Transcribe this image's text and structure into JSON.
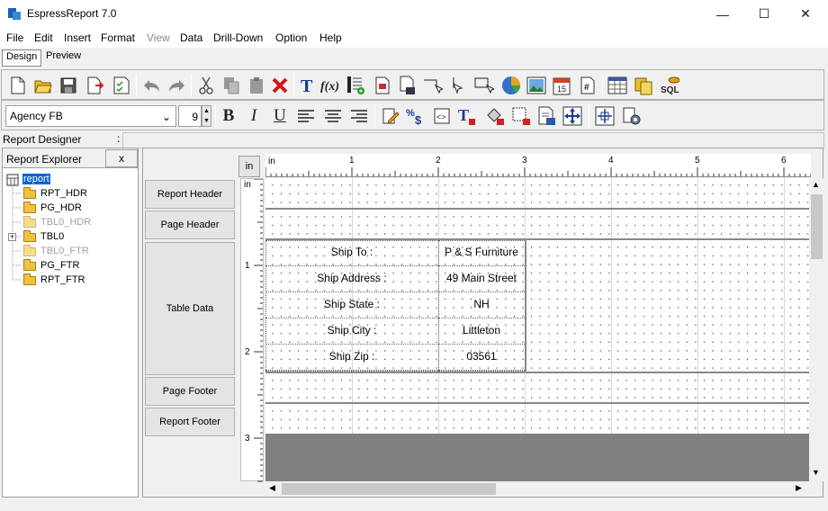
{
  "window": {
    "title": "EspressReport 7.0",
    "minimize": "—",
    "maximize": "☐",
    "close": "✕"
  },
  "menu": [
    "File",
    "Edit",
    "Insert",
    "Format",
    "View",
    "Data",
    "Drill-Down",
    "Option",
    "Help"
  ],
  "tabs": {
    "design": "Design",
    "preview": "Preview"
  },
  "format_bar": {
    "font": "Agency FB",
    "size": "9"
  },
  "designer": {
    "label": "Report Designer",
    "colon": ":"
  },
  "explorer": {
    "title": "Report Explorer",
    "close": "x",
    "root": "report",
    "items": [
      {
        "label": "RPT_HDR",
        "dim": false,
        "expandable": false
      },
      {
        "label": "PG_HDR",
        "dim": false,
        "expandable": false
      },
      {
        "label": "TBL0_HDR",
        "dim": true,
        "expandable": false
      },
      {
        "label": "TBL0",
        "dim": false,
        "expandable": true
      },
      {
        "label": "TBL0_FTR",
        "dim": true,
        "expandable": false
      },
      {
        "label": "PG_FTR",
        "dim": false,
        "expandable": false
      },
      {
        "label": "RPT_FTR",
        "dim": false,
        "expandable": false
      }
    ]
  },
  "sections": {
    "report_header": "Report Header",
    "page_header": "Page Header",
    "table_data": "Table Data",
    "page_footer": "Page Footer",
    "report_footer": "Report Footer"
  },
  "ruler": {
    "unit_button": "in",
    "h_unit": "in",
    "v_unit": "in",
    "h_numbers": [
      "1",
      "2",
      "3",
      "4",
      "5",
      "6"
    ],
    "v_numbers": [
      "1",
      "2",
      "3"
    ]
  },
  "table": {
    "labels": [
      "Ship To :",
      "Ship Address :",
      "Ship State :",
      "Ship City :",
      "Ship Zip :"
    ],
    "values": [
      "P & S Furniture",
      "49 Main Street",
      "NH",
      "Littleton",
      "03561"
    ]
  }
}
